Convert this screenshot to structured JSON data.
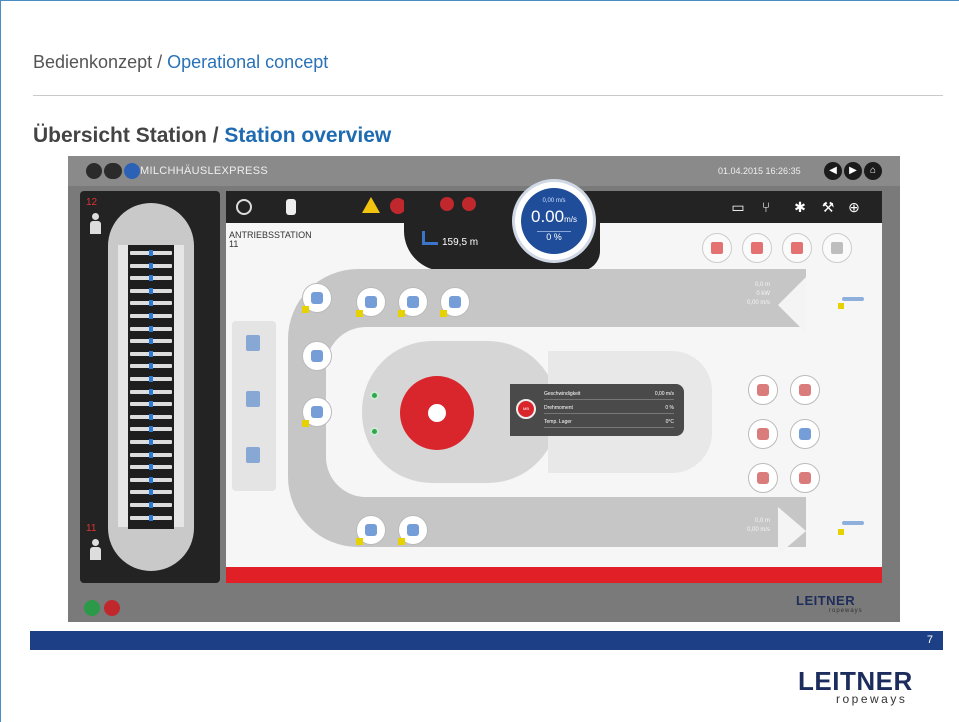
{
  "slide": {
    "breadcrumb_de": "Bedienkonzept",
    "breadcrumb_sep": " / ",
    "breadcrumb_en": "Operational concept",
    "title_de": "Übersicht Station /",
    "title_en": "Station overview",
    "page_number": "7",
    "brand": "LEITNER",
    "brand_sub": "ropeways"
  },
  "hmi": {
    "title": "MILCHHÄUSLEXPRESS",
    "datetime": "01.04.2015  16:26:35",
    "station_name": "ANTRIEBSSTATION",
    "station_no": "11",
    "distance": "159,5 m",
    "speed_top": "0,00 m/s",
    "speed_value": "0.00",
    "speed_unit": "m/s",
    "speed_percent": "0 %",
    "left_top_num": "12",
    "left_bottom_num": "11",
    "track_top_text": [
      "0,0 m",
      "0 kW",
      "0,00 m/s"
    ],
    "track_bottom_text": [
      "0,0 m",
      "0,00 m/s"
    ],
    "info": {
      "speed_label": "Geschwindigkeit",
      "speed_value": "0,00 m/s",
      "torque_label": "Drehmoment",
      "torque_value": "0 %",
      "temp_label": "Temp. Lager",
      "temp_value": "0°C",
      "icon_text": "MB"
    },
    "logo": "LEITNER",
    "logo_sub": "ropeways"
  },
  "colors": {
    "accent_blue": "#1f6bb2",
    "bar_blue": "#1c3f86",
    "alarm_red": "#e02026",
    "warn_yellow": "#f2c40f"
  },
  "icons": [
    "menu-icon",
    "glasses-icon",
    "user-icon",
    "back-icon",
    "play-icon",
    "home-icon",
    "warning-icon",
    "stop-icon",
    "monitor-icon",
    "network-icon",
    "gear-icon",
    "wrench-icon",
    "zoom-icon"
  ]
}
